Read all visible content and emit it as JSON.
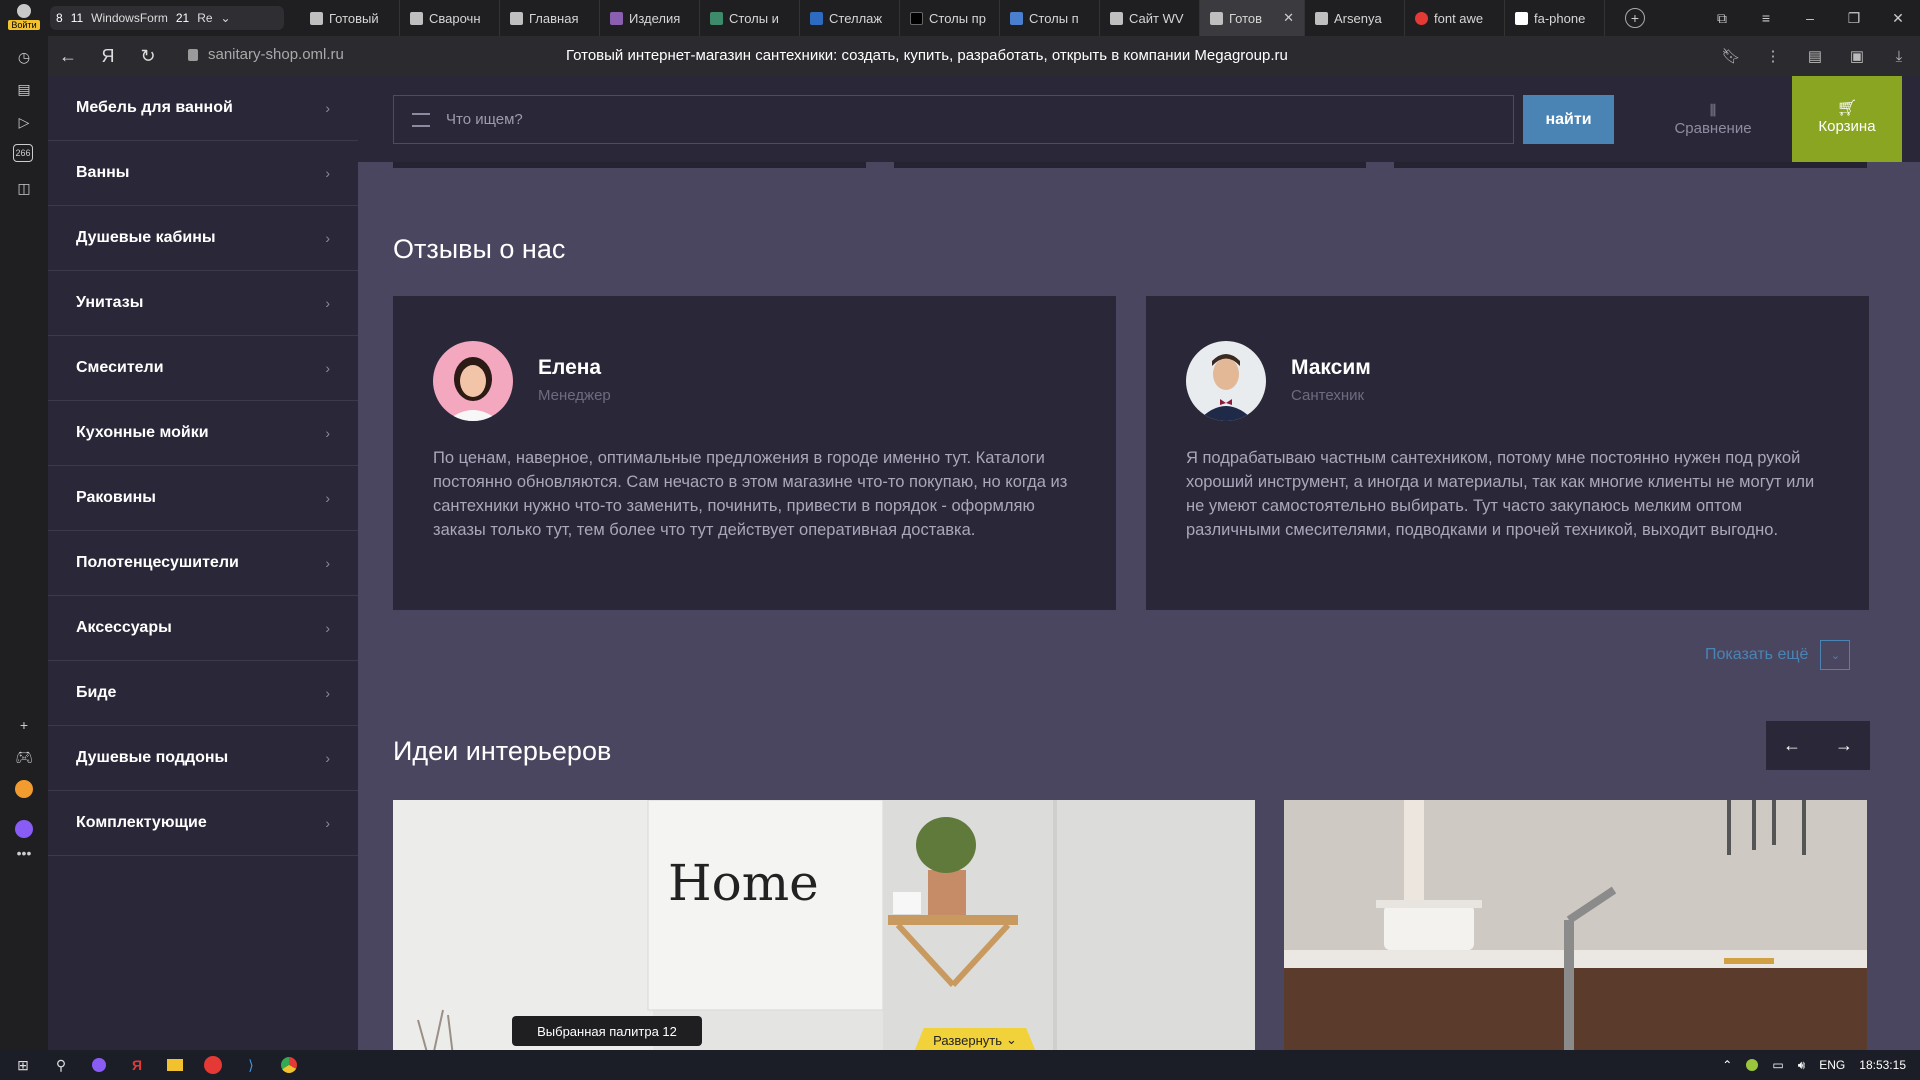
{
  "browser": {
    "profile_label": "Войти",
    "tab_group": {
      "count_a": "8",
      "count_b": "11",
      "name": "WindowsForm",
      "count_c": "21",
      "trail": "Re"
    },
    "tabs": [
      {
        "label": "Готовый",
        "icon": "page-icon"
      },
      {
        "label": "Сварочн",
        "icon": "page-icon"
      },
      {
        "label": "Главная",
        "icon": "page-icon"
      },
      {
        "label": "Изделия",
        "icon": "site-favicon"
      },
      {
        "label": "Столы и",
        "icon": "site-favicon"
      },
      {
        "label": "Стеллаж",
        "icon": "site-favicon"
      },
      {
        "label": "Столы пр",
        "icon": "site-favicon"
      },
      {
        "label": "Столы п",
        "icon": "site-favicon"
      },
      {
        "label": "Сайт WV",
        "icon": "page-icon"
      },
      {
        "label": "Готов",
        "icon": "page-icon",
        "active": true
      },
      {
        "label": "Arsenya",
        "icon": "page-icon"
      },
      {
        "label": "font awe",
        "icon": "yandex-favicon"
      },
      {
        "label": "fa-phone",
        "icon": "flag-favicon"
      }
    ],
    "url": "sanitary-shop.oml.ru",
    "page_title": "Готовый интернет-магазин сантехники: создать, купить, разработать, открыть в компании Megagroup.ru",
    "sidebar_badge": "266"
  },
  "catalog": {
    "items": [
      "Мебель для ванной",
      "Ванны",
      "Душевые кабины",
      "Унитазы",
      "Смесители",
      "Кухонные мойки",
      "Раковины",
      "Полотенцесушители",
      "Аксессуары",
      "Биде",
      "Душевые поддоны",
      "Комплектующие"
    ]
  },
  "header": {
    "search_placeholder": "Что ищем?",
    "find_label": "найти",
    "compare_label": "Сравнение",
    "cart_label": "Корзина"
  },
  "reviews": {
    "title": "Отзывы о нас",
    "items": [
      {
        "name": "Елена",
        "role": "Менеджер",
        "text": "По ценам, наверное, оптимальные предложения в городе именно тут. Каталоги постоянно обновляются. Сам нечасто в этом магазине что-то покупаю, но когда из сантехники нужно что-то заменить, починить, привести в порядок - оформляю заказы только тут, тем более что тут действует оперативная доставка."
      },
      {
        "name": "Максим",
        "role": "Сантехник",
        "text": "Я подрабатываю частным сантехником, потому мне постоянно нужен под рукой хороший инструмент, а иногда и материалы, так как многие клиенты не могут или не умеют самостоятельно выбирать. Тут часто закупаюсь мелким оптом различными смесителями, подводками и прочей техникой, выходит выгодно."
      }
    ],
    "more_label": "Показать ещё"
  },
  "ideas": {
    "title": "Идеи интерьеров",
    "image_text": "Home"
  },
  "overlays": {
    "palette_label": "Выбранная палитра 12",
    "expand_label": "Развернуть"
  },
  "taskbar": {
    "lang": "ENG",
    "time": "18:53:15"
  },
  "colors": {
    "page_bg": "#4a4660",
    "panel_bg": "#2a2838",
    "accent_blue": "#4a84b4",
    "cart_green": "#8aa521"
  }
}
